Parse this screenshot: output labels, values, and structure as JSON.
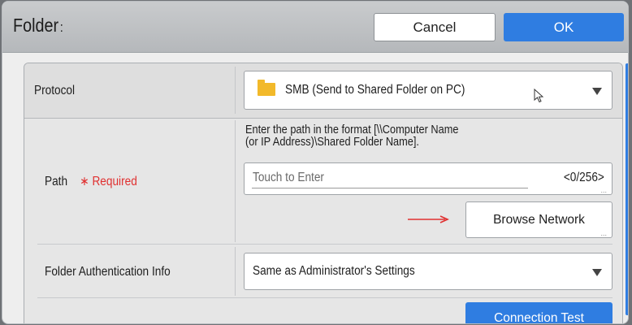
{
  "dialog": {
    "title": "Folder",
    "title_suffix": ":",
    "cancel_label": "Cancel",
    "ok_label": "OK"
  },
  "protocol": {
    "label": "Protocol",
    "value": "SMB (Send to Shared Folder on PC)",
    "icon": "folder-icon"
  },
  "path": {
    "label": "Path",
    "required": "∗ Required",
    "hint_line1": "Enter the path in the format [\\\\Computer Name",
    "hint_line2": "(or IP Address)\\Shared Folder Name].",
    "placeholder": "Touch to Enter",
    "counter": "<0/256>",
    "browse_label": "Browse Network"
  },
  "auth": {
    "label": "Folder Authentication Info",
    "value": "Same as Administrator's Settings"
  },
  "connection_test_label": "Connection Test",
  "colors": {
    "accent": "#2f7de1",
    "required": "#e03030",
    "folder": "#f2b92a"
  }
}
